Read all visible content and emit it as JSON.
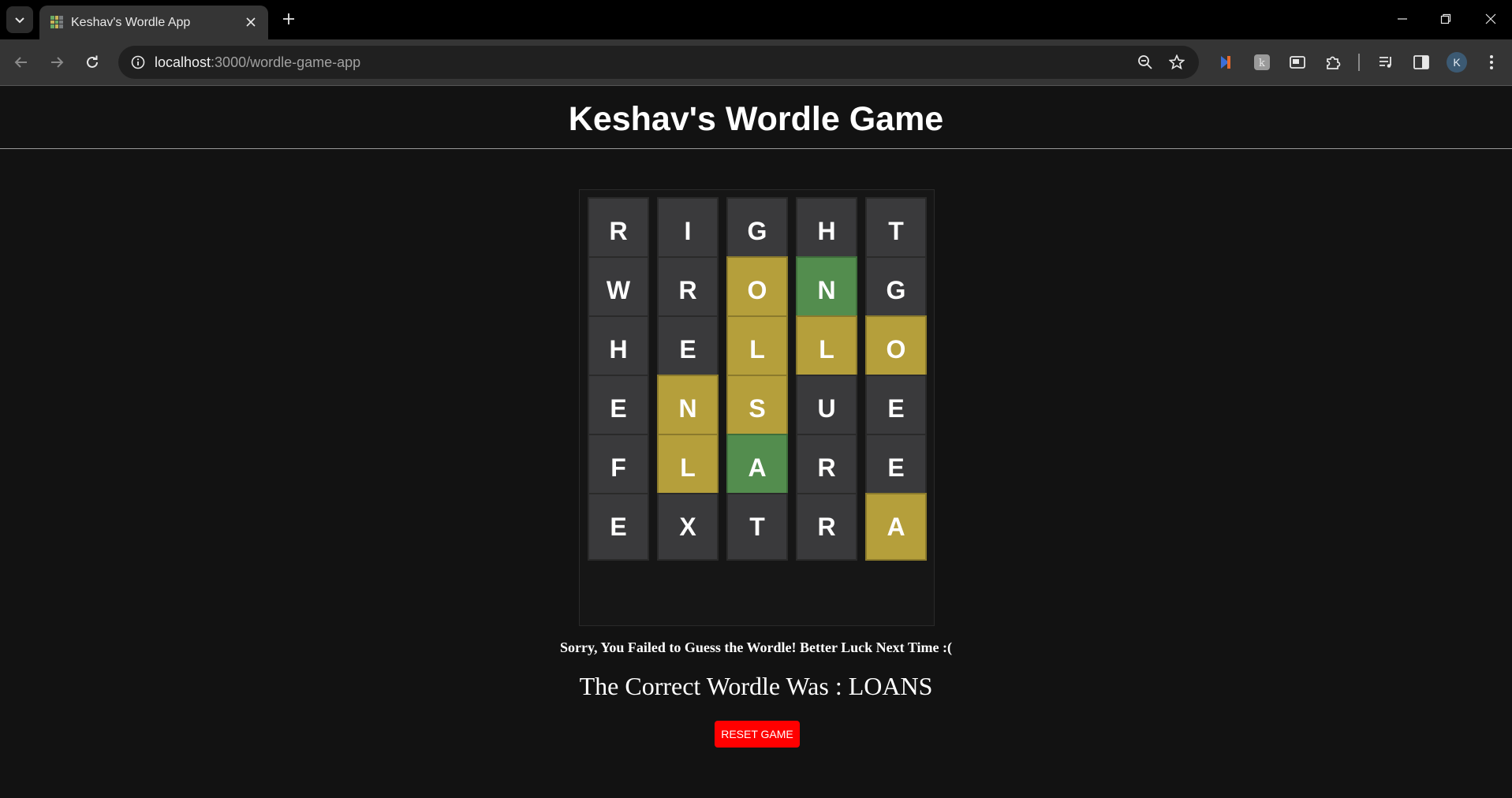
{
  "browser": {
    "tab_title": "Keshav's Wordle App",
    "url_host": "localhost",
    "url_rest": ":3000/wordle-game-app",
    "profile_initial": "K"
  },
  "page": {
    "title": "Keshav's Wordle Game"
  },
  "board": {
    "rows": [
      [
        {
          "letter": "R",
          "state": "absent"
        },
        {
          "letter": "I",
          "state": "absent"
        },
        {
          "letter": "G",
          "state": "absent"
        },
        {
          "letter": "H",
          "state": "absent"
        },
        {
          "letter": "T",
          "state": "absent"
        }
      ],
      [
        {
          "letter": "W",
          "state": "absent"
        },
        {
          "letter": "R",
          "state": "absent"
        },
        {
          "letter": "O",
          "state": "present"
        },
        {
          "letter": "N",
          "state": "correct"
        },
        {
          "letter": "G",
          "state": "absent"
        }
      ],
      [
        {
          "letter": "H",
          "state": "absent"
        },
        {
          "letter": "E",
          "state": "absent"
        },
        {
          "letter": "L",
          "state": "present"
        },
        {
          "letter": "L",
          "state": "present"
        },
        {
          "letter": "O",
          "state": "present"
        }
      ],
      [
        {
          "letter": "E",
          "state": "absent"
        },
        {
          "letter": "N",
          "state": "present"
        },
        {
          "letter": "S",
          "state": "present"
        },
        {
          "letter": "U",
          "state": "absent"
        },
        {
          "letter": "E",
          "state": "absent"
        }
      ],
      [
        {
          "letter": "F",
          "state": "absent"
        },
        {
          "letter": "L",
          "state": "present"
        },
        {
          "letter": "A",
          "state": "correct"
        },
        {
          "letter": "R",
          "state": "absent"
        },
        {
          "letter": "E",
          "state": "absent"
        }
      ],
      [
        {
          "letter": "E",
          "state": "absent"
        },
        {
          "letter": "X",
          "state": "absent"
        },
        {
          "letter": "T",
          "state": "absent"
        },
        {
          "letter": "R",
          "state": "absent"
        },
        {
          "letter": "A",
          "state": "present"
        }
      ]
    ]
  },
  "result": {
    "message": "Sorry, You Failed to Guess the Wordle! Better Luck Next Time :(",
    "answer_text": "The Correct Wordle Was : LOANS"
  },
  "reset_button": {
    "label": "RESET GAME",
    "color": "#ff0000"
  },
  "colors": {
    "correct": "#538d4e",
    "present": "#b59f3b",
    "absent": "#3a3a3c",
    "background": "#121212"
  },
  "icons": [
    "tab-search-icon",
    "favicon-icon",
    "close-icon",
    "plus-icon",
    "minimize-icon",
    "restore-icon",
    "back-arrow-icon",
    "forward-arrow-icon",
    "reload-icon",
    "site-info-icon",
    "zoom-out-icon",
    "star-icon",
    "extension-icon",
    "puzzle-icon",
    "media-icon",
    "sidepanel-icon",
    "menu-dots-icon"
  ]
}
